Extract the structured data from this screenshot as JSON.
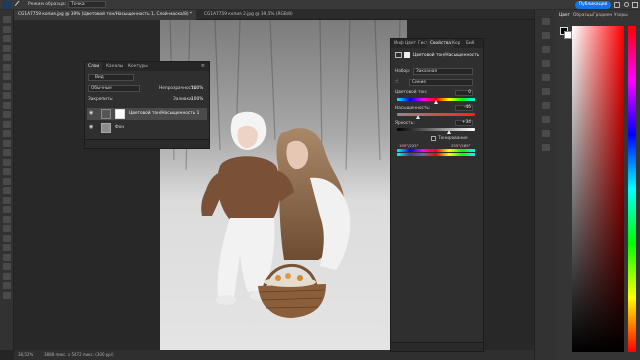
{
  "optionsbar": {
    "mode_label": "Режим образца:",
    "mode_value": "Точка",
    "publish_label": "Публикация"
  },
  "tabs": [
    {
      "label": "CG1A7759 копия.jpg @ 39% (Цветовой тон/Насыщенность 1, Слой-маска/8) *"
    },
    {
      "label": "CG1A7759 копия 2.jpg @ 39,5% (RGB/8)"
    }
  ],
  "status": {
    "zoom": "38,52%",
    "size": "3888 пикс. x 5472 пикс. (300 ppi)"
  },
  "colorpanel": {
    "tabs": [
      "Цвет",
      "Образцы",
      "Градиен",
      "Узоры"
    ]
  },
  "layers": {
    "tabs": [
      "Слои",
      "Каналы",
      "Контуры"
    ],
    "filter": "Вид",
    "blend_mode": "Обычные",
    "opacity_label": "Непрозрачность:",
    "opacity_value": "100%",
    "lock_label": "Закрепить:",
    "fill_label": "Заливка:",
    "fill_value": "100%",
    "items": [
      {
        "name": "Цветовой тон/Насыщенность 1"
      },
      {
        "name": "Фон"
      }
    ]
  },
  "properties": {
    "tabs": [
      "Инф",
      "Цвет",
      "Гист",
      "Свойства",
      "Кор",
      "Биб"
    ],
    "title": "Цветовой тон/Насыщенность",
    "preset_label": "Набор:",
    "preset_value": "Заказная",
    "channel_value": "Синие",
    "hue_label": "Цветовой тон:",
    "hue_value": "0",
    "sat_label": "Насыщенность:",
    "sat_value": "-46",
    "light_label": "Яркость:",
    "light_value": "+34",
    "colorize_label": "Тонирование",
    "range_left": "195°/225°",
    "range_right": "255°/285°",
    "hue": 0,
    "saturation": -46,
    "lightness": 34
  }
}
